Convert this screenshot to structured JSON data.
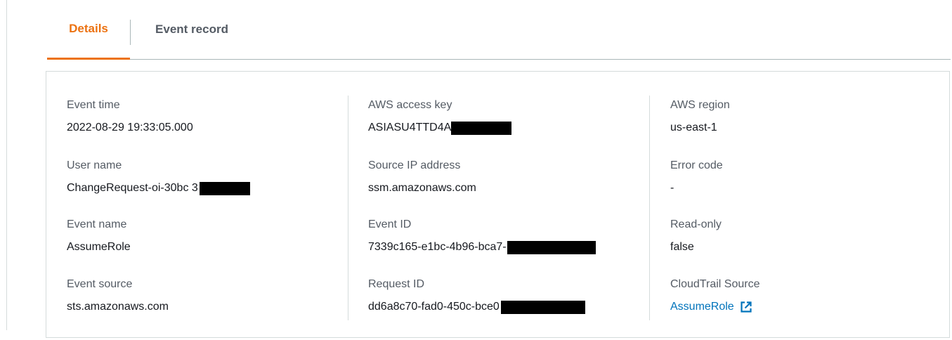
{
  "tabs": [
    {
      "label": "Details",
      "active": true
    },
    {
      "label": "Event record",
      "active": false
    }
  ],
  "colors": {
    "active_tab": "#ec7211",
    "link": "#0073bb",
    "label": "#545b64",
    "value": "#16191f",
    "border": "#d5dbdb"
  },
  "details": {
    "event_time": {
      "label": "Event time",
      "value": "2022-08-29 19:33:05.000"
    },
    "user_name": {
      "label": "User name",
      "value": "ChangeRequest-oi-30bc 3"
    },
    "event_name": {
      "label": "Event name",
      "value": "AssumeRole"
    },
    "event_source": {
      "label": "Event source",
      "value": "sts.amazonaws.com"
    },
    "access_key": {
      "label": "AWS access key",
      "value": "ASIASU4TTD4A"
    },
    "source_ip": {
      "label": "Source IP address",
      "value": "ssm.amazonaws.com"
    },
    "event_id": {
      "label": "Event ID",
      "value": "7339c165-e1bc-4b96-bca7-"
    },
    "request_id": {
      "label": "Request ID",
      "value": "dd6a8c70-fad0-450c-bce0"
    },
    "region": {
      "label": "AWS region",
      "value": "us-east-1"
    },
    "error_code": {
      "label": "Error code",
      "value": "-"
    },
    "read_only": {
      "label": "Read-only",
      "value": "false"
    },
    "cloudtrail_source": {
      "label": "CloudTrail Source",
      "value": "AssumeRole",
      "icon": "external-link-icon"
    }
  }
}
